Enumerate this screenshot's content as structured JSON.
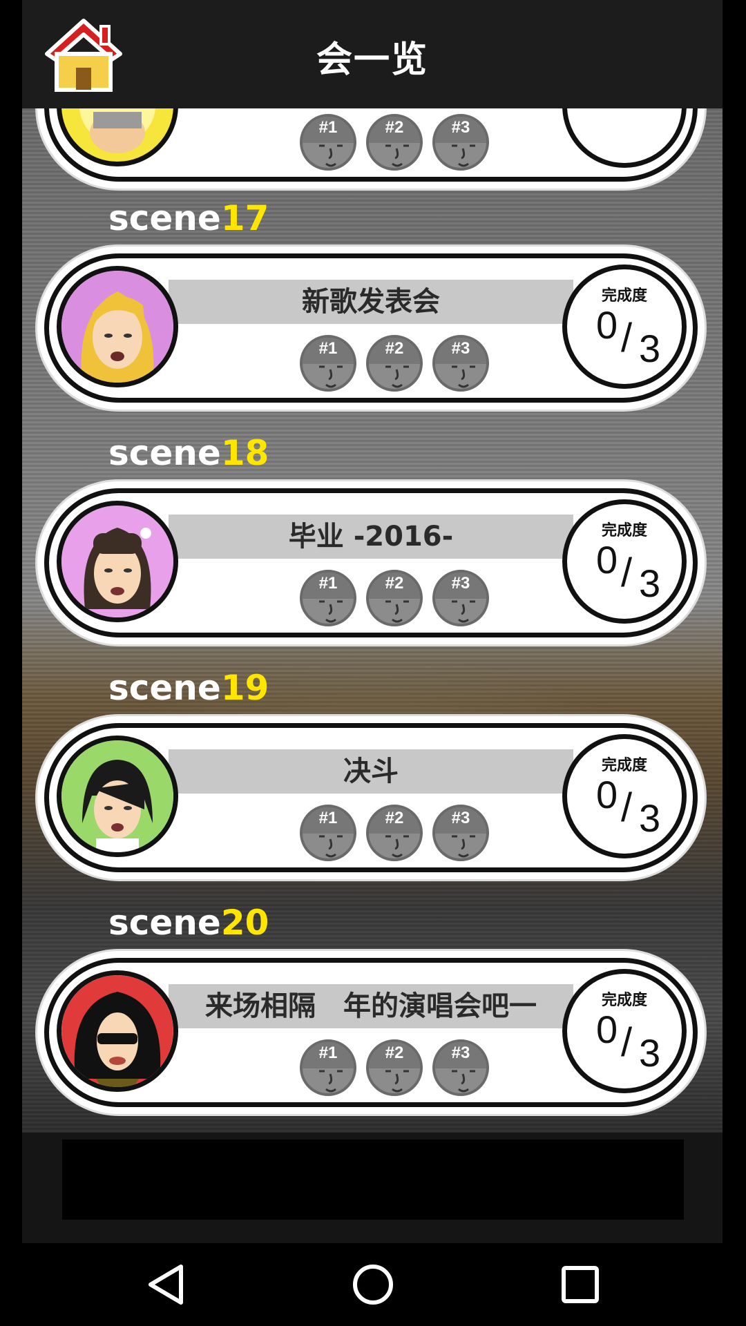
{
  "header": {
    "title": "会一览"
  },
  "top_partial_card": {
    "medals": [
      "#1",
      "#2",
      "#3"
    ]
  },
  "scenes": [
    {
      "label": "scene",
      "number": "17",
      "name": "新歌发表会",
      "completion_label": "完成度",
      "completion_value": "0",
      "completion_total": "3",
      "medals": [
        "#1",
        "#2",
        "#3"
      ],
      "portrait_bg": "#d98ee0",
      "hair": "#f0c23a"
    },
    {
      "label": "scene",
      "number": "18",
      "name": "毕业 -2016-",
      "completion_label": "完成度",
      "completion_value": "0",
      "completion_total": "3",
      "medals": [
        "#1",
        "#2",
        "#3"
      ],
      "portrait_bg": "#e8a0ea",
      "hair": "#3c2e25"
    },
    {
      "label": "scene",
      "number": "19",
      "name": "决斗",
      "completion_label": "完成度",
      "completion_value": "0",
      "completion_total": "3",
      "medals": [
        "#1",
        "#2",
        "#3"
      ],
      "portrait_bg": "#9bd86a",
      "hair": "#1a1a1a"
    },
    {
      "label": "scene",
      "number": "20",
      "name": "来场相隔　年的演唱会吧一",
      "completion_label": "完成度",
      "completion_value": "0",
      "completion_total": "3",
      "medals": [
        "#1",
        "#2",
        "#3"
      ],
      "portrait_bg": "#e03a3a",
      "hair": "#111111"
    }
  ],
  "icons": {
    "home": "home-icon",
    "back": "back-triangle-icon",
    "home_nav": "home-circle-icon",
    "recents": "recents-square-icon"
  },
  "colors": {
    "accent_number": "#ffe600",
    "card_band": "#c8c8c8",
    "medal": "#8c8c8c"
  }
}
